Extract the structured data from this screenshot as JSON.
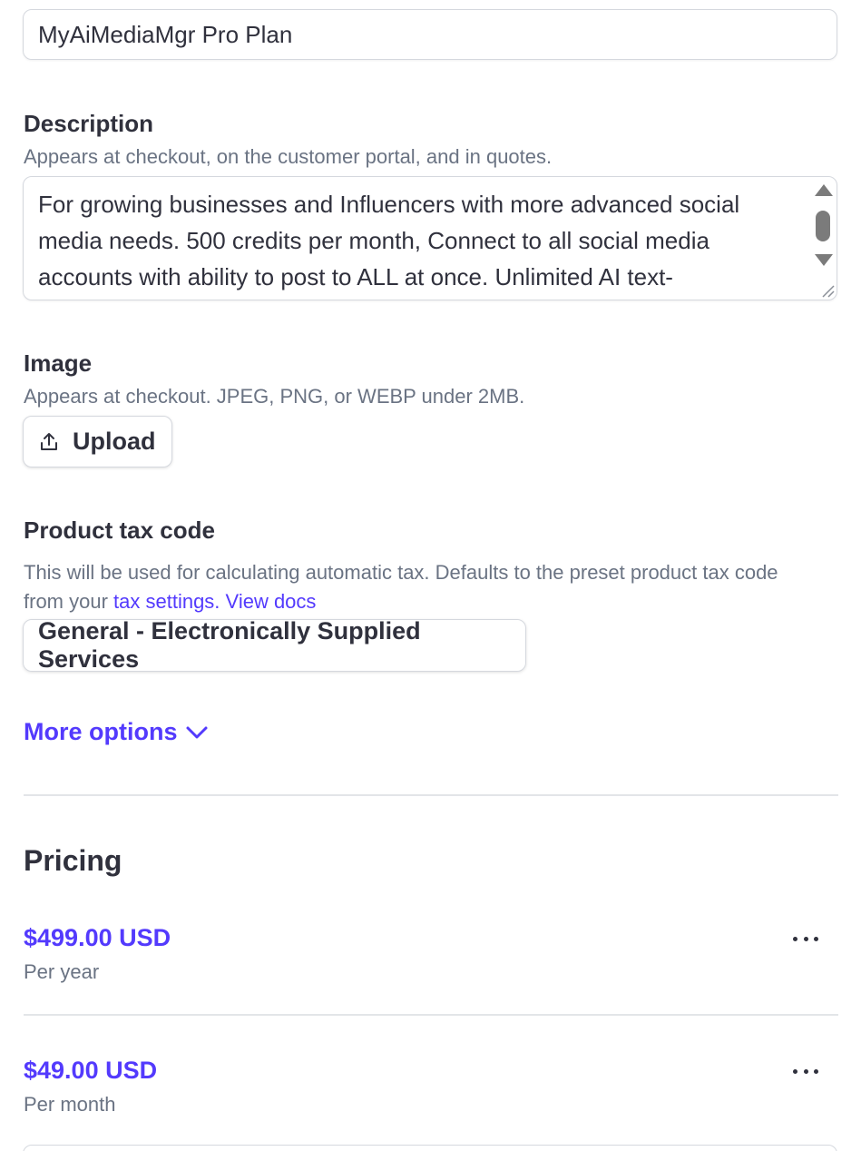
{
  "product": {
    "name_value": "MyAiMediaMgr Pro Plan"
  },
  "description": {
    "label": "Description",
    "hint": "Appears at checkout, on the customer portal, and in quotes.",
    "line1": "For growing businesses and Influencers with more advanced social",
    "line2": "media needs. 500 credits per month, Connect to all social media",
    "line3": "accounts with ability to post to ALL at once. Unlimited AI text-"
  },
  "image": {
    "label": "Image",
    "hint": "Appears at checkout. JPEG, PNG, or WEBP under 2MB.",
    "upload_label": "Upload",
    "upload_icon": "upload-icon"
  },
  "tax": {
    "label": "Product tax code",
    "hint_prefix": "This will be used for calculating automatic tax. Defaults to the preset product tax code from your ",
    "settings_link": "tax settings.",
    "docs_link": "View docs",
    "selected_code": "General - Electronically Supplied Services"
  },
  "more_options": {
    "label": "More options",
    "icon": "chevron-down-icon"
  },
  "pricing": {
    "title": "Pricing",
    "prices": [
      {
        "amount": "$499.00 USD",
        "interval": "Per year"
      },
      {
        "amount": "$49.00 USD",
        "interval": "Per month"
      }
    ]
  },
  "colors": {
    "accent": "#533afd",
    "text": "#30313d",
    "muted": "#6a7383",
    "border": "#d5d8de"
  }
}
